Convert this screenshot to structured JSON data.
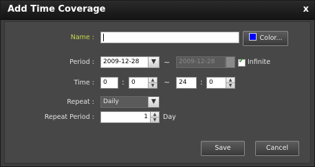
{
  "title": "Add Time Coverage",
  "close_glyph": "x",
  "name_label": "Name :",
  "name_value": "",
  "color_button": "Color...",
  "color_value": "#0000ff",
  "period_label": "Period :",
  "period_start": "2009-12-28",
  "period_sep": "~",
  "period_end": "2009-12-28",
  "infinite_label": "Infinite",
  "infinite_checked": true,
  "time_label": "Time :",
  "time_start_hour": "0",
  "time_start_min": "0",
  "time_end_hour": "24",
  "time_end_min": "0",
  "time_colon": ":",
  "time_sep": "~",
  "repeat_label": "Repeat :",
  "repeat_value": "Daily",
  "repeat_period_label": "Repeat Period :",
  "repeat_period_value": "1",
  "repeat_period_unit": "Day",
  "save_label": "Save",
  "cancel_label": "Cancel"
}
